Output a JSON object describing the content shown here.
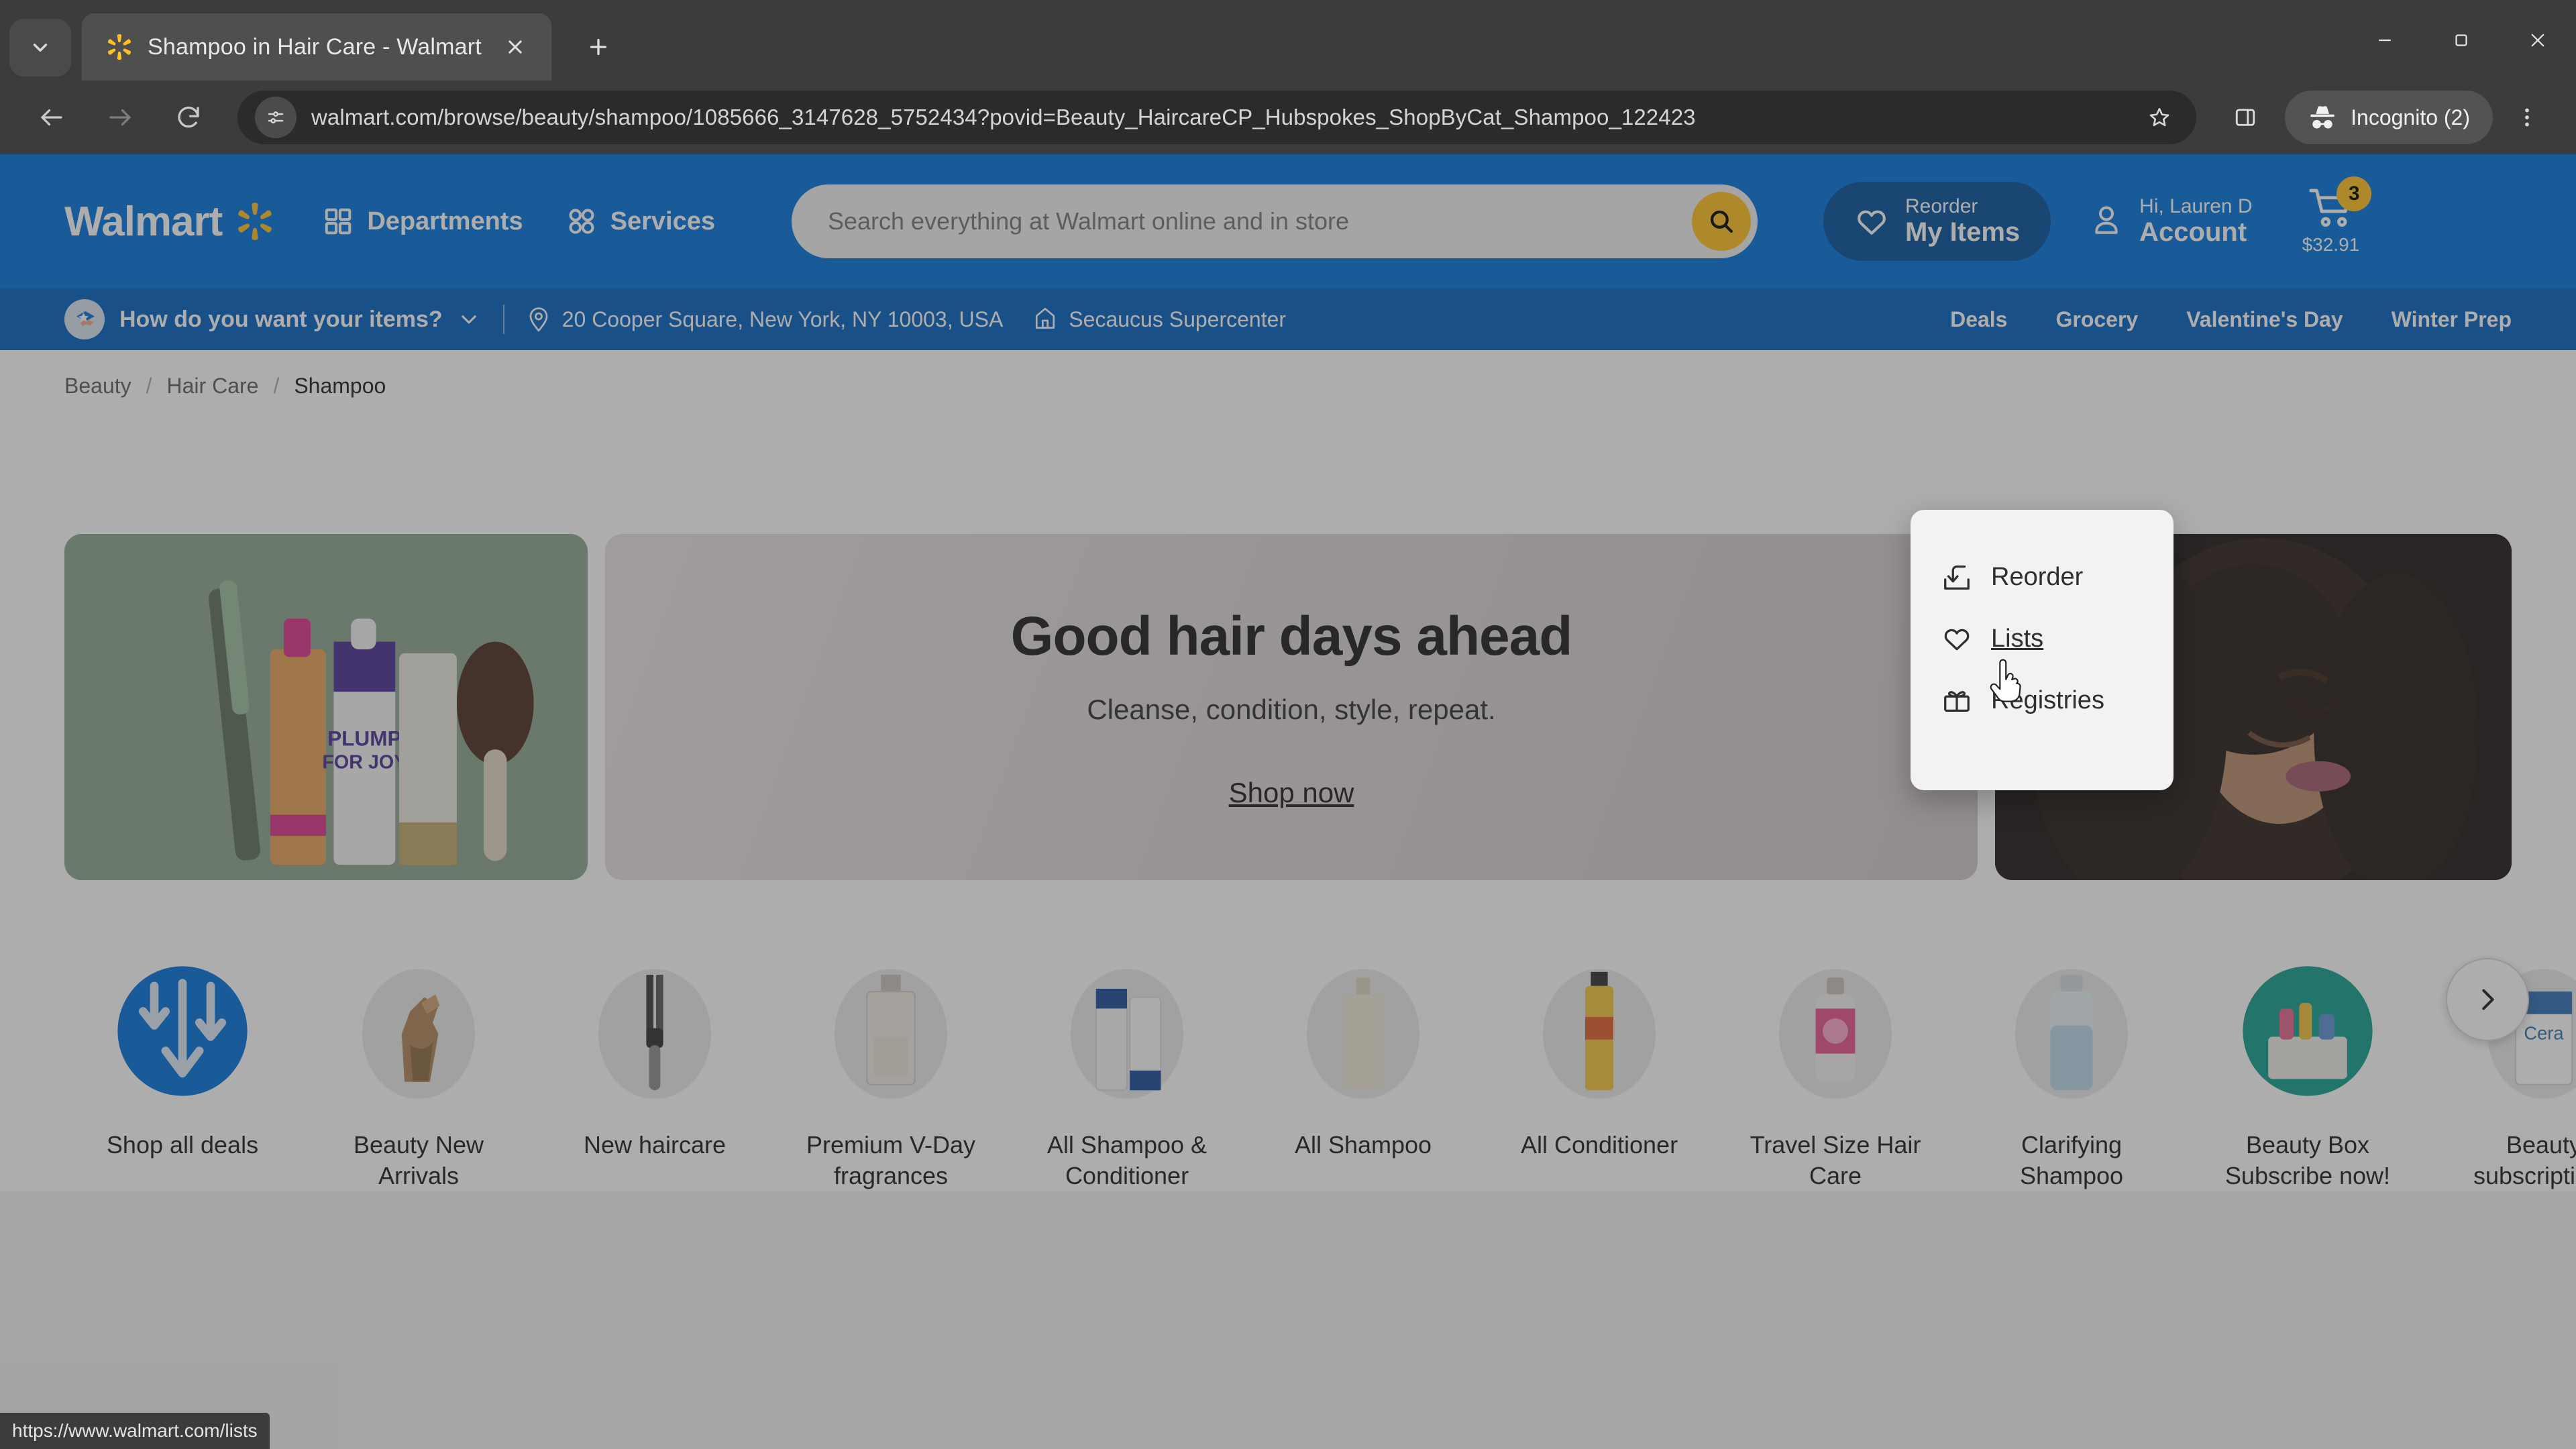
{
  "browser": {
    "tab": {
      "title": "Shampoo in Hair Care - Walmart.com",
      "favicon_icon": "walmart-spark-icon",
      "close_icon": "close-icon"
    },
    "tab_search_icon": "chevron-down-icon",
    "new_tab_icon": "plus-icon",
    "window_controls": {
      "minimize_icon": "minimize-icon",
      "maximize_icon": "maximize-restore-icon",
      "close_icon": "window-close-icon"
    },
    "toolbar": {
      "back_icon": "arrow-left-icon",
      "forward_icon": "arrow-right-icon",
      "reload_icon": "reload-icon",
      "site_info_icon": "site-settings-icon",
      "url": "walmart.com/browse/beauty/shampoo/1085666_3147628_5752434?povid=Beauty_HaircareCP_Hubspokes_ShopByCat_Shampoo_122423",
      "bookmark_icon": "star-icon",
      "side_panel_icon": "side-panel-icon",
      "incognito_label": "Incognito (2)",
      "incognito_icon": "incognito-hat-icon",
      "menu_icon": "three-dot-menu-icon"
    },
    "status_bar_url": "https://www.walmart.com/lists"
  },
  "header": {
    "brand": "Walmart",
    "brand_spark_icon": "walmart-spark-icon",
    "departments_label": "Departments",
    "departments_icon": "grid-icon",
    "services_label": "Services",
    "services_icon": "circles-icon",
    "search": {
      "placeholder": "Search everything at Walmart online and in store",
      "value": "",
      "button_icon": "search-icon"
    },
    "reorder_pill": {
      "top_label": "Reorder",
      "bottom_label": "My Items",
      "icon": "heart-icon"
    },
    "account": {
      "top_label": "Hi, Lauren D",
      "bottom_label": "Account",
      "icon": "person-icon"
    },
    "cart": {
      "icon": "cart-icon",
      "count": "3",
      "total": "$32.91"
    }
  },
  "subbar": {
    "fulfillment_label": "How do you want your items?",
    "fulfillment_chevron_icon": "chevron-down-icon",
    "location_icon": "map-pin-icon",
    "address": "20 Cooper Square, New York, NY 10003, USA",
    "store_icon": "store-icon",
    "store_name": "Secaucus Supercenter",
    "nav_links": [
      "Deals",
      "Grocery",
      "Valentine's Day",
      "Winter Prep"
    ]
  },
  "breadcrumb": {
    "items": [
      "Beauty",
      "Hair Care",
      "Shampoo"
    ],
    "separator": "/"
  },
  "account_menu": {
    "items": [
      {
        "label": "Reorder",
        "icon": "reorder-box-arrow-icon",
        "hovered": false
      },
      {
        "label": "Lists",
        "icon": "heart-icon",
        "hovered": true
      },
      {
        "label": "Registries",
        "icon": "gift-icon",
        "hovered": false
      }
    ],
    "cursor_icon": "pointing-hand-cursor"
  },
  "hero": {
    "left_tile_alt": "hair styling tools and products on green background",
    "title": "Good hair days ahead",
    "subtitle": "Cleanse, condition, style, repeat.",
    "cta": "Shop now",
    "right_tile_alt": "woman with curly hair portrait"
  },
  "categories": {
    "next_icon": "chevron-right-icon",
    "items": [
      {
        "label": "Shop all deals",
        "art": "deals-arrows"
      },
      {
        "label": "Beauty New Arrivals",
        "art": "bronze-figure"
      },
      {
        "label": "New haircare",
        "art": "flat-iron"
      },
      {
        "label": "Premium V-Day fragrances",
        "art": "perfume-bottle"
      },
      {
        "label": "All Shampoo & Conditioner",
        "art": "two-bottles"
      },
      {
        "label": "All Shampoo",
        "art": "cream-bottle"
      },
      {
        "label": "All Conditioner",
        "art": "yellow-tube"
      },
      {
        "label": "Travel Size Hair Care",
        "art": "pink-mini-bottle"
      },
      {
        "label": "Clarifying Shampoo",
        "art": "blue-bottle"
      },
      {
        "label": "Beauty Box Subscribe now!",
        "art": "teal-box"
      },
      {
        "label": "Beauty subscriptions",
        "art": "cerave-box"
      }
    ]
  },
  "colors": {
    "walmart_blue": "#0071dc",
    "walmart_dark_blue": "#004f9a",
    "walmart_subbar_blue": "#0060bf",
    "walmart_yellow": "#ffc220",
    "chrome_bg": "#3c3c3c"
  }
}
